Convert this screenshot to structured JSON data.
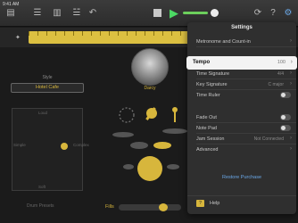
{
  "status_bar": {
    "time": "9:41 AM"
  },
  "toolbar": {
    "icons": [
      "menu-icon",
      "tracks-icon",
      "mixer-icon",
      "fx-icon",
      "undo-icon",
      "stop-icon",
      "play-icon",
      "loop-icon",
      "help-icon",
      "settings-icon"
    ]
  },
  "drummer": {
    "style_label": "Style",
    "style_value": "Hotel Cafe",
    "name": "Darcy",
    "pad_top": "Loud",
    "pad_bottom": "Soft",
    "pad_left": "Simple",
    "pad_right": "Complex",
    "preset_label": "Drum Presets",
    "fills_label": "Fills",
    "fills_level": 0.65
  },
  "settings": {
    "title": "Settings",
    "rows": [
      {
        "label": "Metronome and Count-in",
        "value": ""
      },
      {
        "label": "Tempo",
        "value": "100"
      },
      {
        "label": "Time Signature",
        "value": "4/4"
      },
      {
        "label": "Key Signature",
        "value": "C major"
      },
      {
        "label": "Time Ruler",
        "value": ""
      },
      {
        "label": "Fade Out",
        "value": ""
      },
      {
        "label": "Note Pad",
        "value": ""
      },
      {
        "label": "Jam Session",
        "value": "Not Connected"
      },
      {
        "label": "Advanced",
        "value": ""
      }
    ],
    "restore_label": "Restore Purchase",
    "help_label": "Help"
  },
  "colors": {
    "accent": "#d7b63c",
    "play": "#4cd964",
    "link": "#6aa8e8"
  }
}
